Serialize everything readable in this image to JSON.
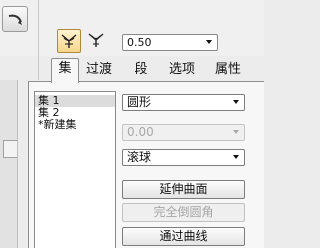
{
  "toolbar": {
    "value_combo": "0.50"
  },
  "tabs": [
    {
      "label": "集",
      "active": true
    },
    {
      "label": "过渡",
      "active": false
    },
    {
      "label": "段",
      "active": false
    },
    {
      "label": "选项",
      "active": false
    },
    {
      "label": "属性",
      "active": false
    }
  ],
  "sets": [
    "集 1",
    "集 2",
    "*新建集"
  ],
  "selected_set": "集 1",
  "controls": {
    "shape_dropdown": "圆形",
    "value_dropdown": "0.00",
    "mode_dropdown": "滚球",
    "extend_surface_button": "延伸曲面",
    "full_round_button": "完全倒圆角",
    "through_curve_button": "通过曲线"
  },
  "colors": {
    "active_tool": "#f6d68c",
    "disabled_text": "#a8a8a8"
  }
}
